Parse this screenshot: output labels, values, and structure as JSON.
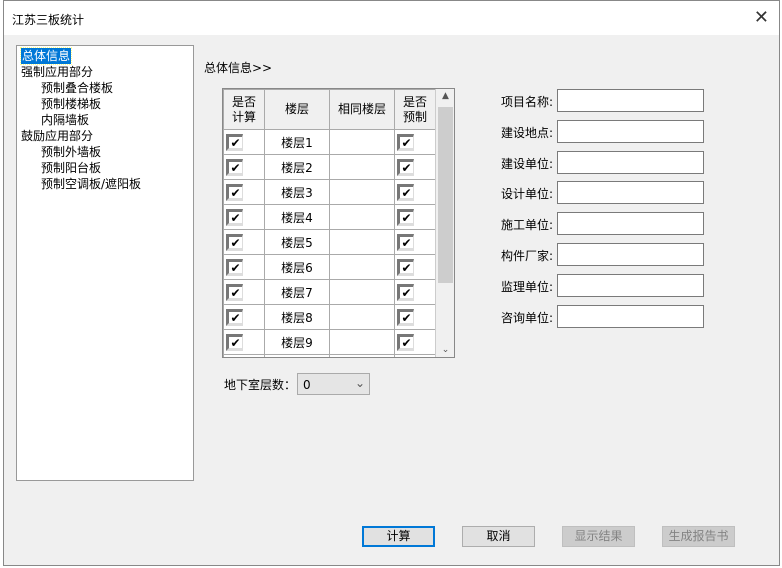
{
  "title": "江苏三板统计",
  "tree": [
    {
      "label": "总体信息",
      "level": 1,
      "selected": true
    },
    {
      "label": "强制应用部分",
      "level": 1
    },
    {
      "label": "预制叠合楼板",
      "level": 2
    },
    {
      "label": "预制楼梯板",
      "level": 2
    },
    {
      "label": "内隔墙板",
      "level": 2
    },
    {
      "label": "鼓励应用部分",
      "level": 1
    },
    {
      "label": "预制外墙板",
      "level": 2
    },
    {
      "label": "预制阳台板",
      "level": 2
    },
    {
      "label": "预制空调板/遮阳板",
      "level": 2
    }
  ],
  "breadcrumb": "总体信息>>",
  "grid": {
    "headers": [
      "是否\n计算",
      "楼层",
      "相同楼层",
      "是否\n预制"
    ],
    "rows": [
      {
        "calc": true,
        "floor": "楼层1",
        "same": "",
        "prefab": true
      },
      {
        "calc": true,
        "floor": "楼层2",
        "same": "",
        "prefab": true
      },
      {
        "calc": true,
        "floor": "楼层3",
        "same": "",
        "prefab": true
      },
      {
        "calc": true,
        "floor": "楼层4",
        "same": "",
        "prefab": true
      },
      {
        "calc": true,
        "floor": "楼层5",
        "same": "",
        "prefab": true
      },
      {
        "calc": true,
        "floor": "楼层6",
        "same": "",
        "prefab": true
      },
      {
        "calc": true,
        "floor": "楼层7",
        "same": "",
        "prefab": true
      },
      {
        "calc": true,
        "floor": "楼层8",
        "same": "",
        "prefab": true
      },
      {
        "calc": true,
        "floor": "楼层9",
        "same": "",
        "prefab": true
      }
    ]
  },
  "basement": {
    "label": "地下室层数：",
    "value": "0"
  },
  "fields": [
    {
      "label": "项目名称:",
      "value": ""
    },
    {
      "label": "建设地点:",
      "value": ""
    },
    {
      "label": "建设单位:",
      "value": ""
    },
    {
      "label": "设计单位:",
      "value": ""
    },
    {
      "label": "施工单位:",
      "value": ""
    },
    {
      "label": "构件厂家:",
      "value": ""
    },
    {
      "label": "监理单位:",
      "value": ""
    },
    {
      "label": "咨询单位:",
      "value": ""
    }
  ],
  "buttons": {
    "calc": "计算",
    "cancel": "取消",
    "show": "显示结果",
    "report": "生成报告书"
  }
}
